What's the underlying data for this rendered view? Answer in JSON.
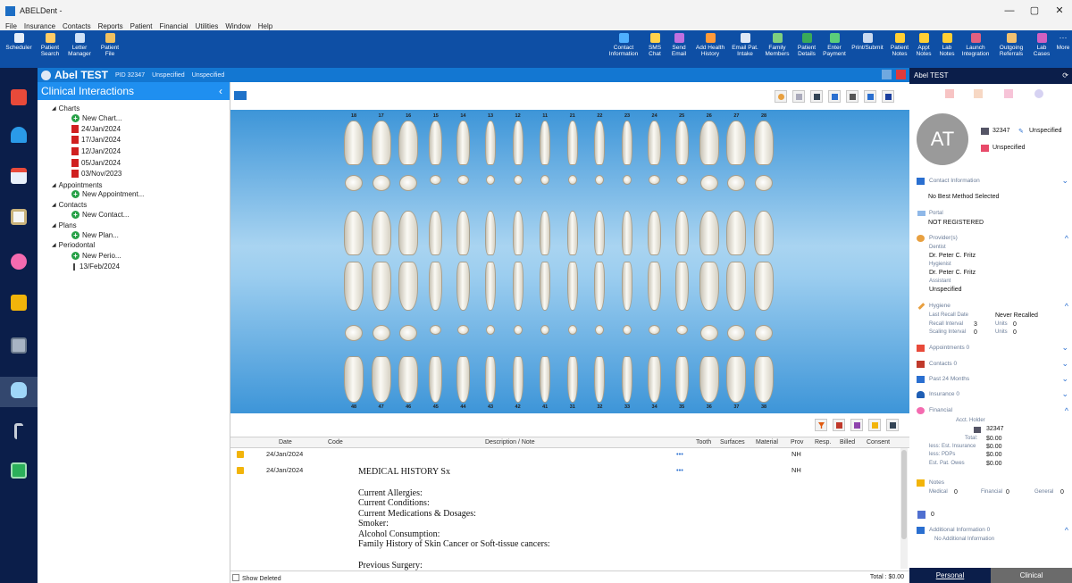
{
  "window": {
    "title": "ABELDent -"
  },
  "menu": [
    "File",
    "Insurance",
    "Contacts",
    "Reports",
    "Patient",
    "Financial",
    "Utilities",
    "Window",
    "Help"
  ],
  "toolbar_left": [
    {
      "label": "Scheduler",
      "icon": "calendar-icon"
    },
    {
      "label": "Patient Search",
      "icon": "person-search-icon"
    },
    {
      "label": "Letter Manager",
      "icon": "letter-icon"
    },
    {
      "label": "Patient File",
      "icon": "folder-icon"
    }
  ],
  "toolbar_right": [
    {
      "label": "Contact Information",
      "icon": "contact-card-icon"
    },
    {
      "label": "SMS Chat",
      "icon": "chat-icon"
    },
    {
      "label": "Send Email",
      "icon": "email-icon"
    },
    {
      "label": "Add Health History",
      "icon": "health-history-icon"
    },
    {
      "label": "Email Pat. Intake",
      "icon": "intake-icon"
    },
    {
      "label": "Family Members",
      "icon": "family-icon"
    },
    {
      "label": "Patient Details",
      "icon": "details-icon"
    },
    {
      "label": "Enter Payment",
      "icon": "payment-icon"
    },
    {
      "label": "Print/Submit",
      "icon": "print-icon"
    },
    {
      "label": "Patient Notes",
      "icon": "notes-icon"
    },
    {
      "label": "Appt Notes",
      "icon": "appt-notes-icon"
    },
    {
      "label": "Lab Notes",
      "icon": "lab-notes-icon"
    },
    {
      "label": "Launch Integration",
      "icon": "launch-icon"
    },
    {
      "label": "Outgoing Referrals",
      "icon": "referral-icon"
    },
    {
      "label": "Lab Cases",
      "icon": "lab-icon"
    },
    {
      "label": "More",
      "icon": "more-icon"
    }
  ],
  "patient": {
    "name": "Abel TEST",
    "pid": "PID 32347",
    "info1": "Unspecified",
    "info2": "Unspecified"
  },
  "tree": {
    "title": "Clinical Interactions",
    "charts": "Charts",
    "new_chart": "New Chart...",
    "chart_dates": [
      "24/Jan/2024",
      "17/Jan/2024",
      "12/Jan/2024",
      "05/Jan/2024",
      "03/Nov/2023"
    ],
    "appointments": "Appointments",
    "new_appointment": "New Appointment...",
    "contacts": "Contacts",
    "new_contact": "New Contact...",
    "plans": "Plans",
    "new_plan": "New Plan...",
    "periodontal": "Periodontal",
    "new_perio": "New Perio...",
    "perio_date": "13/Feb/2024"
  },
  "tooth_numbers_upper": [
    "18",
    "17",
    "16",
    "15",
    "14",
    "13",
    "12",
    "11",
    "21",
    "22",
    "23",
    "24",
    "25",
    "26",
    "27",
    "28"
  ],
  "tooth_numbers_lower": [
    "48",
    "47",
    "46",
    "45",
    "44",
    "43",
    "42",
    "41",
    "31",
    "32",
    "33",
    "34",
    "35",
    "36",
    "37",
    "38"
  ],
  "grid": {
    "headers": [
      "Date",
      "Code",
      "Description / Note",
      "Tooth",
      "Surfaces",
      "Material",
      "Prov",
      "Resp.",
      "Billed",
      "Consent"
    ],
    "rows": [
      {
        "date": "24/Jan/2024",
        "dots": "•••",
        "prov": "NH"
      },
      {
        "date": "24/Jan/2024",
        "dots": "•••",
        "prov": "NH"
      }
    ],
    "note_title": "MEDICAL HISTORY Sx",
    "note_lines": [
      "Current Allergies:",
      "Current Conditions:",
      "Current Medications & Dosages:",
      "Smoker:",
      "Alcohol Consumption:",
      "Family History of Skin Cancer or Soft-tissue cancers:"
    ],
    "note_after": "Previous Surgery:",
    "show_deleted": "Show Deleted",
    "total": "Total : $0.00"
  },
  "right": {
    "header": "Abel TEST",
    "initials": "AT",
    "id": "32347",
    "status1": "Unspecified",
    "status2": "Unspecified",
    "contact_info": "Contact Information",
    "best_method": "No Best Method Selected",
    "portal_label": "Portal",
    "portal_value": "NOT REGISTERED",
    "providers_label": "Provider(s)",
    "dentist_label": "Dentist",
    "dentist": "Dr. Peter C. Fritz",
    "hygienist_label": "Hygienist",
    "hygienist": "Dr. Peter C. Fritz",
    "assistant_label": "Assistant",
    "assistant": "Unspecified",
    "hygiene_label": "Hygiene",
    "last_recall_label": "Last Recall Date",
    "last_recall": "Never Recalled",
    "recall_interval_label": "Recall Interval",
    "recall_interval": "3",
    "recall_units_label": "Units",
    "recall_units": "0",
    "scaling_label": "Scaling Interval",
    "scaling_interval": "0",
    "scaling_units_label": "Units",
    "scaling_units": "0",
    "appointments": "Appointments 0",
    "contacts": "Contacts 0",
    "past24": "Past 24 Months",
    "insurance": "Insurance 0",
    "financial": "Financial",
    "acct_holder_label": "Acct. Holder",
    "acct_holder": "32347",
    "total_label": "Total:",
    "total": "$0.00",
    "ins_label": "less: Est. Insurance",
    "ins": "$0.00",
    "pdp_label": "less: PDPs",
    "pdp": "$0.00",
    "owes_label": "Est. Pat. Owes",
    "owes": "$0.00",
    "notes_label": "Notes",
    "medical_label": "Medical",
    "medical": "0",
    "fin_label": "Financial",
    "fin": "0",
    "gen_label": "General",
    "gen": "0",
    "misc_count": "0",
    "addl_label": "Additional Information 0",
    "addl_value": "No Additional Information",
    "tab_personal": "Personal",
    "tab_clinical": "Clinical"
  }
}
